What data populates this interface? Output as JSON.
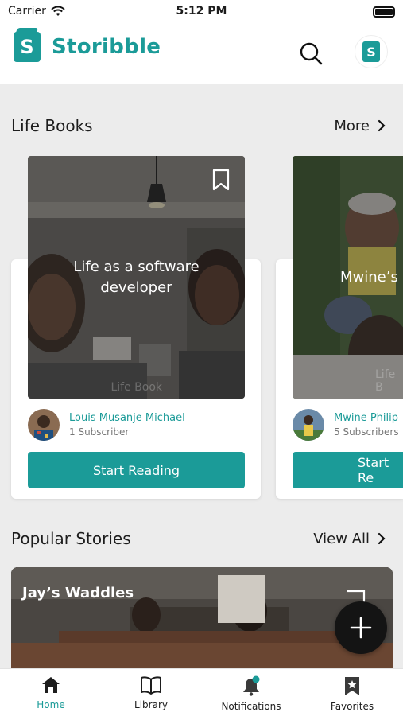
{
  "status_bar": {
    "carrier": "Carrier",
    "time": "5:12 PM"
  },
  "app": {
    "name": "Storibble",
    "logo_letter": "S"
  },
  "colors": {
    "accent": "#1b9b98",
    "background": "#ececec",
    "fab": "#141414"
  },
  "life_books": {
    "title": "Life Books",
    "link": "More",
    "cards": [
      {
        "title": "Life as a software developer",
        "badge": "Life Book",
        "author": "Louis Musanje Michael",
        "subscribers": "1 Subscriber",
        "button": "Start Reading"
      },
      {
        "title": "Mwine’s",
        "badge": "Life B",
        "author": "Mwine Philip",
        "subscribers": "5 Subscribers",
        "button": "Start Re"
      }
    ]
  },
  "popular_stories": {
    "title": "Popular Stories",
    "link": "View All",
    "items": [
      {
        "title": "Jay’s Waddles"
      }
    ]
  },
  "tabbar": [
    {
      "label": "Home",
      "icon": "home-icon",
      "active": true
    },
    {
      "label": "Library",
      "icon": "book-icon",
      "active": false
    },
    {
      "label": "Notifications",
      "icon": "bell-icon",
      "active": false
    },
    {
      "label": "Favorites",
      "icon": "bookmark-star-icon",
      "active": false
    }
  ]
}
